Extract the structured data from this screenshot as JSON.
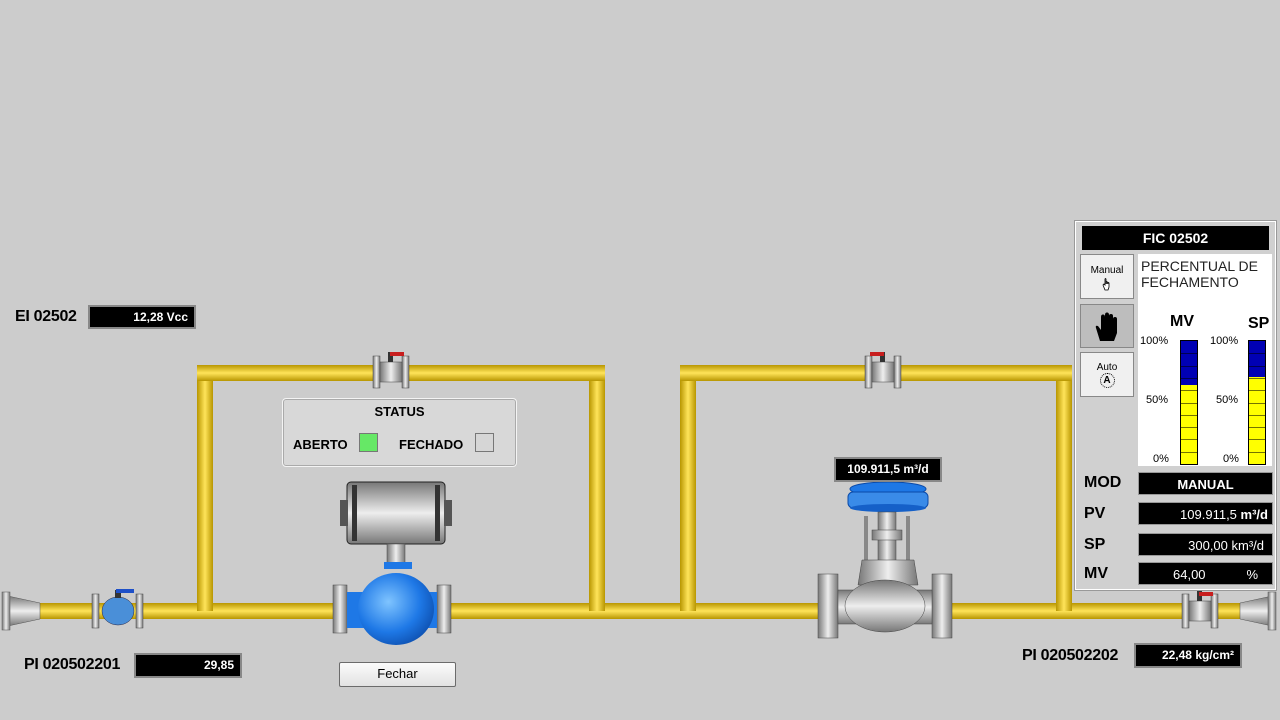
{
  "ei": {
    "label": "EI 02502",
    "value": "12,28 Vcc"
  },
  "pi1": {
    "label": "PI 020502201",
    "value": "29,85"
  },
  "pi2": {
    "label": "PI 020502202",
    "value": "22,48 kg/cm²"
  },
  "flow_display": "109.911,5 m³/d",
  "status": {
    "title": "STATUS",
    "aberto_label": "ABERTO",
    "fechado_label": "FECHADO",
    "aberto_color": "#66e866",
    "fechado_color": "#d6d6d6"
  },
  "fechar_button": "Fechar",
  "fic": {
    "title": "FIC 02502",
    "manual_label": "Manual",
    "auto_label": "Auto",
    "auto_badge": "A",
    "description": "PERCENTUAL DE FECHAMENTO",
    "mv_label": "MV",
    "sp_label": "SP",
    "scale": [
      "100%",
      "50%",
      "0%"
    ],
    "mv_level": 0.64,
    "sp_level": 0.71,
    "rows": {
      "mod": {
        "label": "MOD",
        "value": "MANUAL"
      },
      "pv": {
        "label": "PV",
        "value": "109.911,5",
        "unit": "m³/d"
      },
      "sp": {
        "label": "SP",
        "value": "300,00 km³/d"
      },
      "mv": {
        "label": "MV",
        "value": "64,00",
        "unit": "%"
      }
    }
  },
  "colors": {
    "pipe": "#f2cc00",
    "background": "#cccccc",
    "valve_blue": "#1e78e6",
    "bar_fill": "#ffff00",
    "bar_empty": "#0000b4"
  }
}
